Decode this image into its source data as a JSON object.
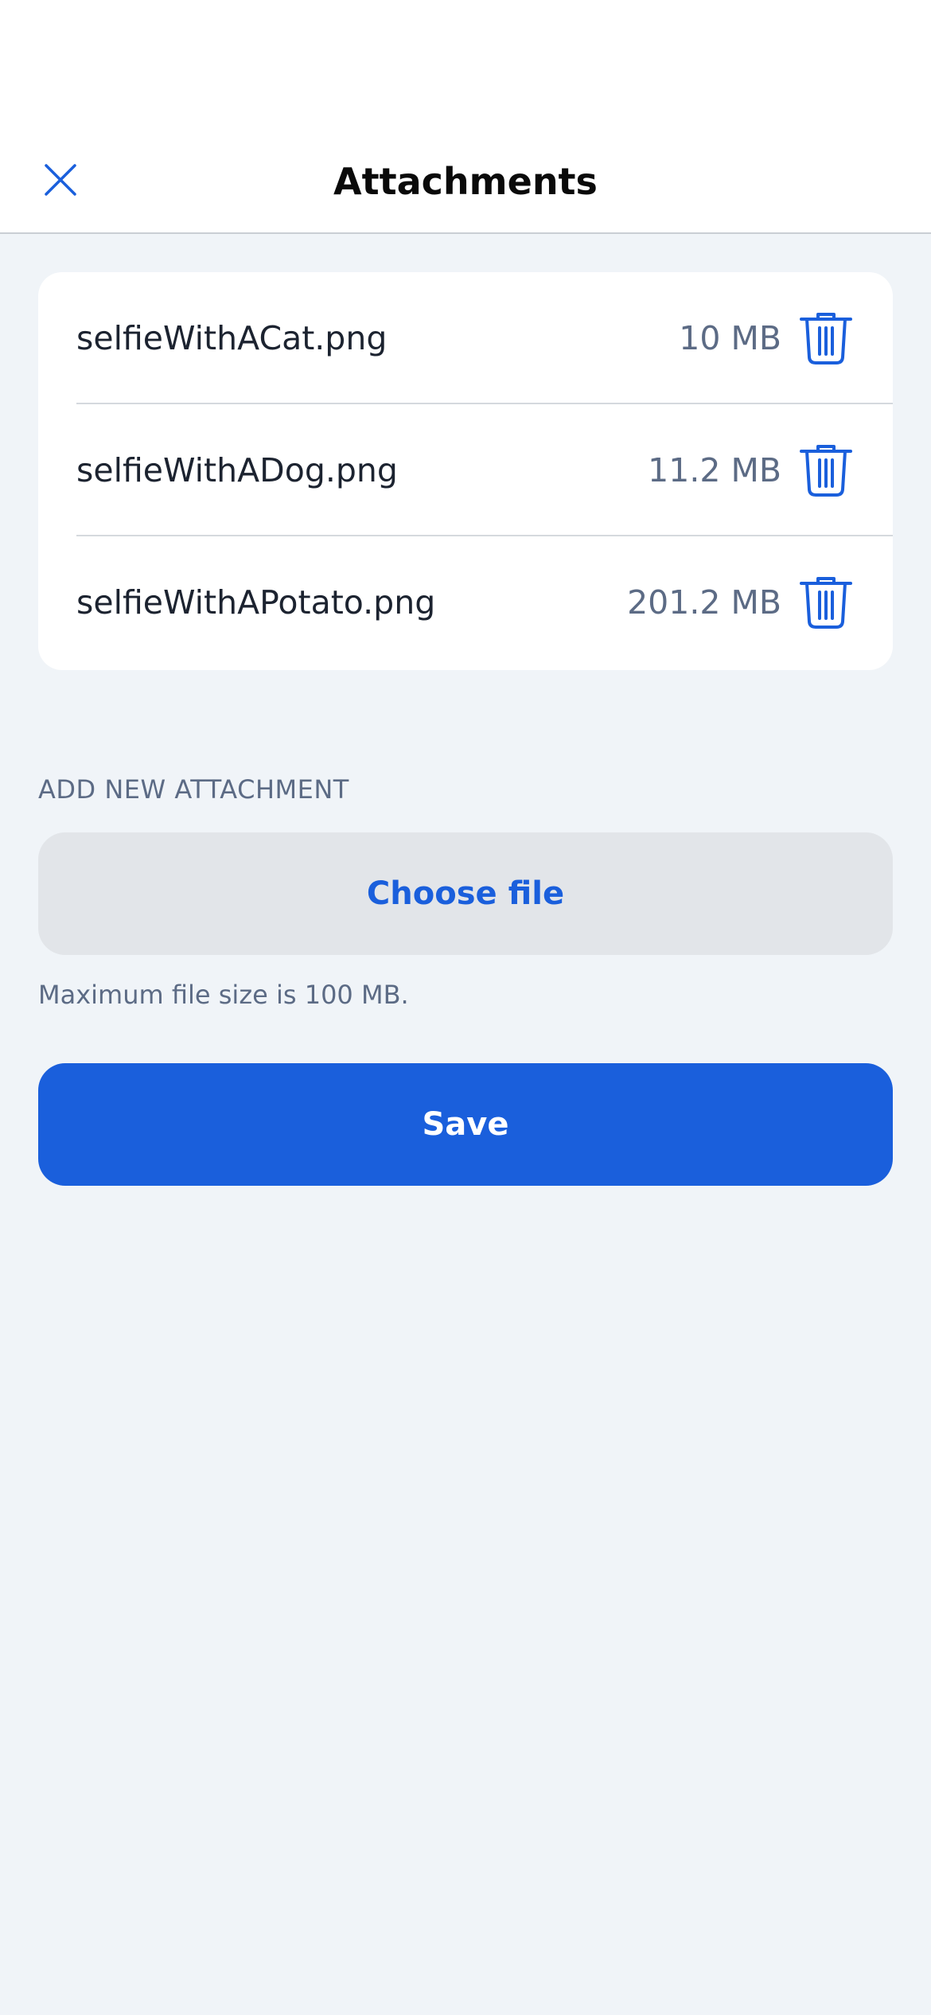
{
  "header": {
    "title": "Attachments",
    "close_icon": "close-icon"
  },
  "attachments": [
    {
      "name": "selfieWithACat.png",
      "size": "10 MB",
      "delete_icon": "trash-icon"
    },
    {
      "name": "selfieWithADog.png",
      "size": "11.2 MB",
      "delete_icon": "trash-icon"
    },
    {
      "name": "selfieWithAPotato.png",
      "size": "201.2 MB",
      "delete_icon": "trash-icon"
    }
  ],
  "add_section": {
    "label": "ADD NEW ATTACHMENT",
    "choose_file_label": "Choose file",
    "hint": "Maximum file size is 100 MB."
  },
  "actions": {
    "save_label": "Save"
  },
  "colors": {
    "accent": "#1a5fdc",
    "background": "#f0f4f8",
    "card": "#ffffff",
    "muted_text": "#5c6b85",
    "secondary_button": "#e2e5e9"
  }
}
